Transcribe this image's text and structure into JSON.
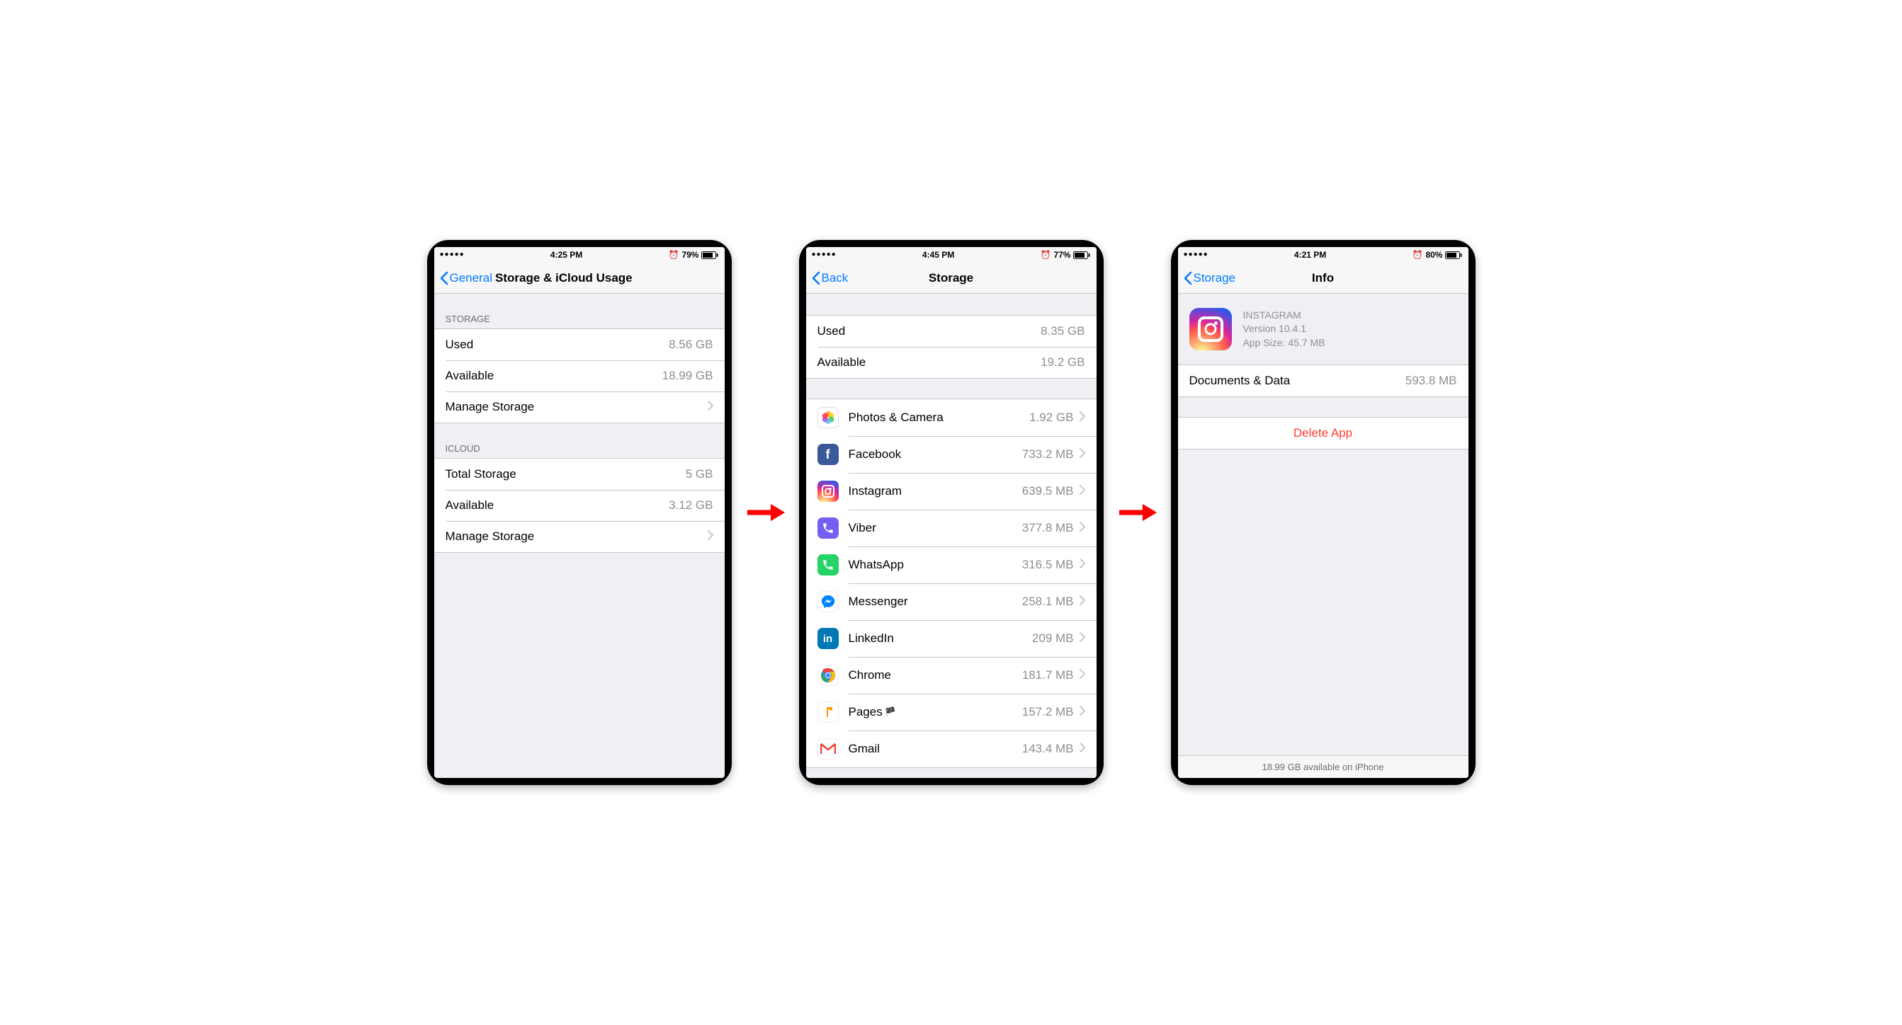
{
  "screen1": {
    "status": {
      "time": "4:25 PM",
      "battery": "79%"
    },
    "nav": {
      "back": "General",
      "title": "Storage & iCloud Usage"
    },
    "storage_header": "STORAGE",
    "storage": {
      "used_label": "Used",
      "used_value": "8.56 GB",
      "avail_label": "Available",
      "avail_value": "18.99 GB",
      "manage_label": "Manage Storage"
    },
    "icloud_header": "ICLOUD",
    "icloud": {
      "total_label": "Total Storage",
      "total_value": "5 GB",
      "avail_label": "Available",
      "avail_value": "3.12 GB",
      "manage_label": "Manage Storage"
    }
  },
  "screen2": {
    "status": {
      "time": "4:45 PM",
      "battery": "77%"
    },
    "nav": {
      "back": "Back",
      "title": "Storage"
    },
    "summary": {
      "used_label": "Used",
      "used_value": "8.35 GB",
      "avail_label": "Available",
      "avail_value": "19.2 GB"
    },
    "apps": [
      {
        "name": "Photos & Camera",
        "size": "1.92 GB",
        "icon": "photos"
      },
      {
        "name": "Facebook",
        "size": "733.2 MB",
        "icon": "facebook"
      },
      {
        "name": "Instagram",
        "size": "639.5 MB",
        "icon": "instagram"
      },
      {
        "name": "Viber",
        "size": "377.8 MB",
        "icon": "viber"
      },
      {
        "name": "WhatsApp",
        "size": "316.5 MB",
        "icon": "whatsapp"
      },
      {
        "name": "Messenger",
        "size": "258.1 MB",
        "icon": "messenger"
      },
      {
        "name": "LinkedIn",
        "size": "209 MB",
        "icon": "linkedin"
      },
      {
        "name": "Chrome",
        "size": "181.7 MB",
        "icon": "chrome"
      },
      {
        "name": "Pages",
        "size": "157.2 MB",
        "icon": "pages",
        "flag": true
      },
      {
        "name": "Gmail",
        "size": "143.4 MB",
        "icon": "gmail"
      }
    ]
  },
  "screen3": {
    "status": {
      "time": "4:21 PM",
      "battery": "80%"
    },
    "nav": {
      "back": "Storage",
      "title": "Info"
    },
    "app": {
      "name": "INSTAGRAM",
      "version": "Version 10.4.1",
      "size": "App Size: 45.7 MB"
    },
    "docs_label": "Documents & Data",
    "docs_value": "593.8 MB",
    "delete_label": "Delete App",
    "footer": "18.99 GB available on iPhone"
  }
}
